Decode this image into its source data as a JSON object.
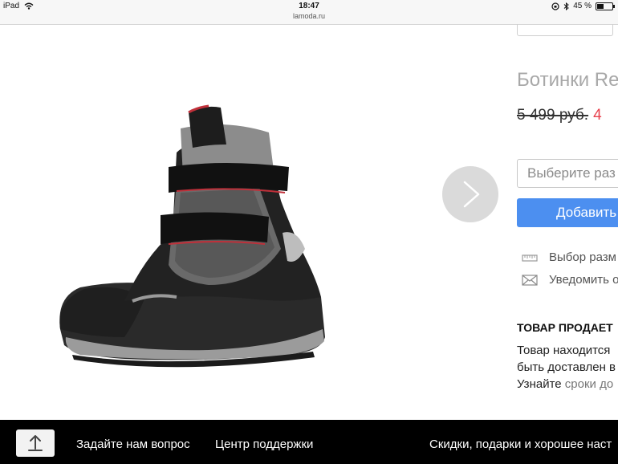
{
  "status_bar": {
    "device": "iPad",
    "time": "18:47",
    "url": "lamoda.ru",
    "battery": "45 %",
    "battery_level": 0.45
  },
  "product": {
    "title": "Ботинки Re",
    "old_price": "5 499 руб.",
    "new_price": "4 ",
    "image_icon": "winter-boot-image",
    "next_icon": "chevron-right-icon"
  },
  "actions": {
    "size_placeholder": "Выберите раз",
    "add_label": "Добавить"
  },
  "links": {
    "size_guide": "Выбор разм",
    "notify": "Уведомить о",
    "size_guide_icon": "ruler-icon",
    "notify_icon": "envelope-icon"
  },
  "seller": {
    "heading": "ТОВАР ПРОДАЕТ",
    "line1": "Товар находится",
    "line2": "быть доставлен в",
    "line3_prefix": "Узнайте",
    "line3_link": "сроки до"
  },
  "bottom_bar": {
    "upload_icon": "share-upload-icon",
    "ask_question": "Задайте нам вопрос",
    "support_center": "Центр поддержки",
    "promo": "Скидки, подарки и хорошее наст"
  },
  "colors": {
    "accent": "#4c8ff0",
    "sale_price": "#e8414d",
    "bottom_bar": "#000000"
  }
}
